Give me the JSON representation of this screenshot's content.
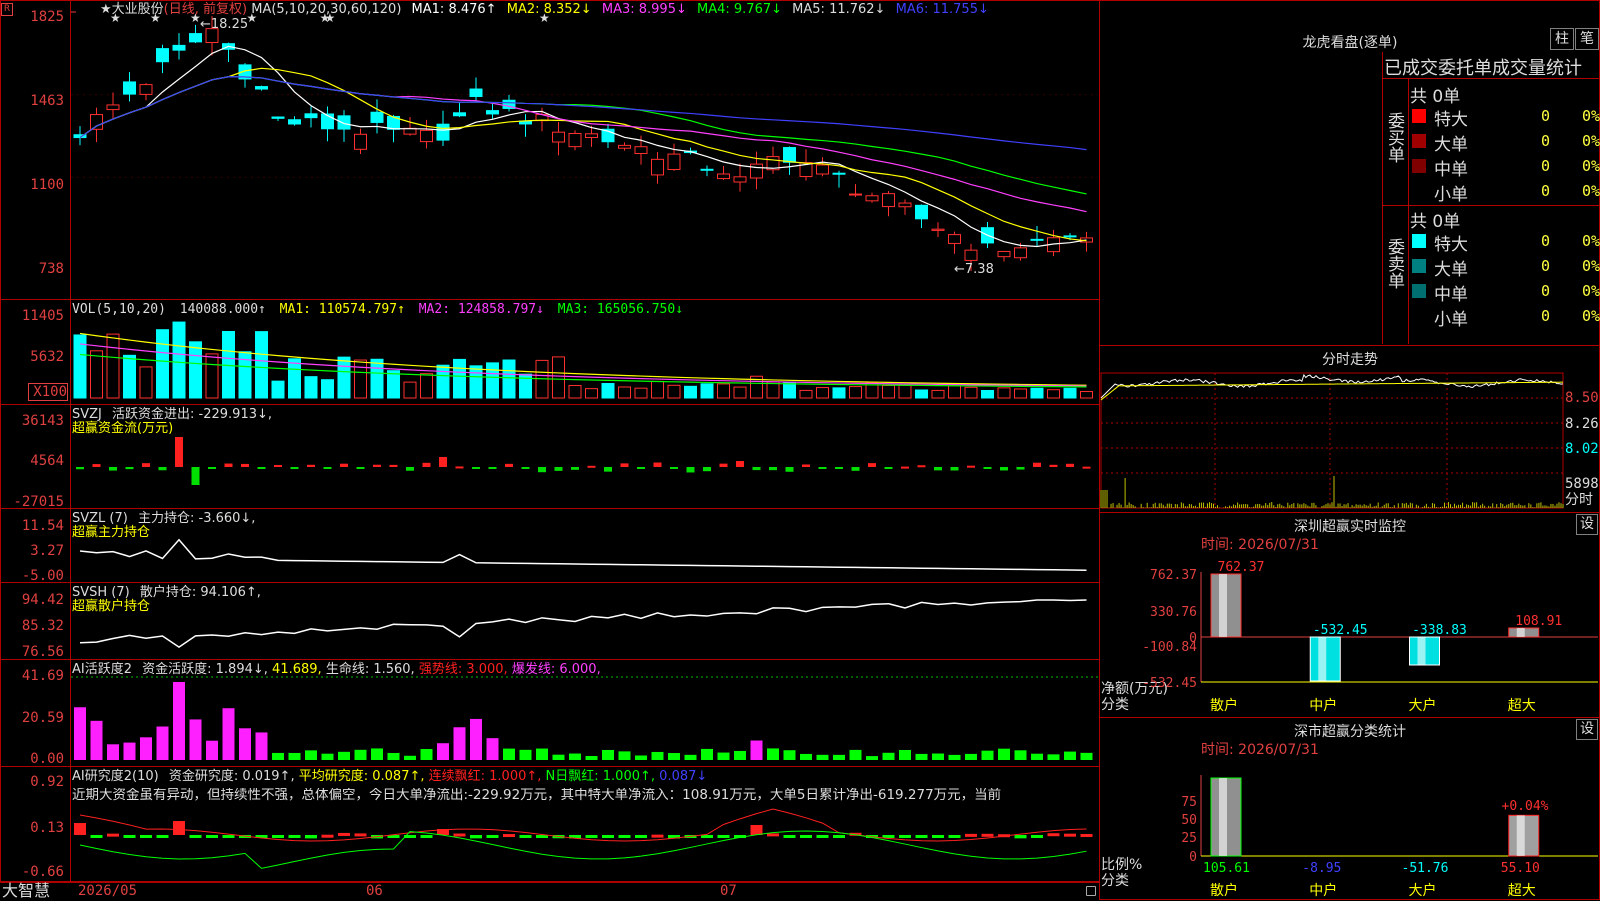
{
  "main": {
    "ma_title": "MA(5,10,20,30,60,120)",
    "star": "★",
    "stock_name": "大业股份",
    "period_mode": "(日线, 前复权)",
    "ma1": "MA1: 8.476↑",
    "ma2": "MA2: 8.352↓",
    "ma3": "MA3: 8.995↓",
    "ma4": "MA4: 9.767↓",
    "ma5": "MA5: 11.762↓",
    "ma6": "MA6: 11.755↓",
    "high_label": "←18.25",
    "low_label": "←7.38",
    "yticks": [
      "1825",
      "1463",
      "1100",
      "738"
    ],
    "badge": "R"
  },
  "vol": {
    "title": "VOL(5,10,20)",
    "value": "140088.000↑",
    "ma1": "MA1: 110574.797↑",
    "ma2": "MA2: 124858.797↓",
    "ma3": "MA3: 165056.750↓",
    "yticks": [
      "11405",
      "5632",
      "X100"
    ]
  },
  "svzj": {
    "title": "SVZJ",
    "label": "活跃资金进出: -229.913↓,",
    "sub": "超赢资金流(万元)",
    "yticks": [
      "36143",
      "4564",
      "-27015"
    ]
  },
  "svzl": {
    "title": "SVZL (7)",
    "label": "主力持仓: -3.660↓,",
    "sub": "超赢主力持仓",
    "yticks": [
      "11.54",
      "3.27",
      "-5.00"
    ]
  },
  "svsh": {
    "title": "SVSH (7)",
    "label": "散户持仓: 94.106↑,",
    "sub": "超赢散户持仓",
    "yticks": [
      "94.42",
      "85.32",
      "76.56"
    ]
  },
  "ai1": {
    "title": "AI活跃度2",
    "label": "资金活跃度: 1.894↓,",
    "v2": "41.689,",
    "v3": "生命线: 1.560,",
    "v4": "强势线: 3.000,",
    "v5": "爆发线: 6.000,",
    "yticks": [
      "41.69",
      "20.59",
      "0.00"
    ]
  },
  "ai2": {
    "title": "AI研究度2(10)",
    "label": "资金研究度: 0.019↑,",
    "v2": "平均研究度: 0.087↑,",
    "v3": "连续飘红: 1.000↑,",
    "v4": "N日飘红: 1.000↑,",
    "v5": "0.087↓",
    "comment": "近期大资金虽有异动，但持续性不强，总体偏空，今日大单净流出:-229.92万元，其中特大单净流入：108.91万元，大单5日累计净出-619.277万元，当前",
    "yticks": [
      "0.92",
      "0.13",
      "-0.66"
    ]
  },
  "bottom": {
    "brand": "大智慧",
    "dates": [
      "2026/05",
      "06",
      "07"
    ]
  },
  "dragon": {
    "title": "龙虎看盘(逐单)",
    "btn1": "柱",
    "btn2": "笔",
    "header": "已成交委托单成交量统计",
    "buy_total": "共 0单",
    "buy_side": "委买单",
    "sell_total": "共 0单",
    "sell_side": "委卖单",
    "buy_rows": [
      {
        "name": "特大",
        "v": "0",
        "p": "0%",
        "color": "#ff0000"
      },
      {
        "name": "大单",
        "v": "0",
        "p": "0%",
        "color": "#a00000"
      },
      {
        "name": "中单",
        "v": "0",
        "p": "0%",
        "color": "#800000"
      },
      {
        "name": "小单",
        "v": "0",
        "p": "0%",
        "color": ""
      }
    ],
    "sell_rows": [
      {
        "name": "特大",
        "v": "0",
        "p": "0%",
        "color": "#00ffff"
      },
      {
        "name": "大单",
        "v": "0",
        "p": "0%",
        "color": "#008080"
      },
      {
        "name": "中单",
        "v": "0",
        "p": "0%",
        "color": "#006f6f"
      },
      {
        "name": "小单",
        "v": "0",
        "p": "0%",
        "color": ""
      }
    ]
  },
  "intraday": {
    "title": "分时走势",
    "yticks": [
      "8.50",
      "8.26",
      "8.02"
    ],
    "vol_label": "5898",
    "vol_unit": "分时"
  },
  "szmon": {
    "title": "深圳超赢实时监控",
    "btn": "设",
    "time": "时间: 2026/07/31",
    "yticks": [
      "762.37",
      "330.76",
      "0",
      "-100.84",
      "-532.45"
    ],
    "ylabel": "净额(万元)",
    "xlabel": "分类",
    "cats": [
      "散户",
      "中户",
      "大户",
      "超大"
    ],
    "values": [
      "762.37",
      "-532.45",
      "-338.83",
      "108.91"
    ]
  },
  "szcls": {
    "title": "深市超赢分类统计",
    "btn": "设",
    "time": "时间: 2026/07/31",
    "yticks": [
      "75",
      "50",
      "25",
      "0"
    ],
    "ylabel": "比例%",
    "xlabel": "分类",
    "cats": [
      "散户",
      "中户",
      "大户",
      "超大"
    ],
    "values": [
      "105.61",
      "-8.95",
      "-51.76",
      "55.10"
    ],
    "top_label": "+0.04%"
  }
}
